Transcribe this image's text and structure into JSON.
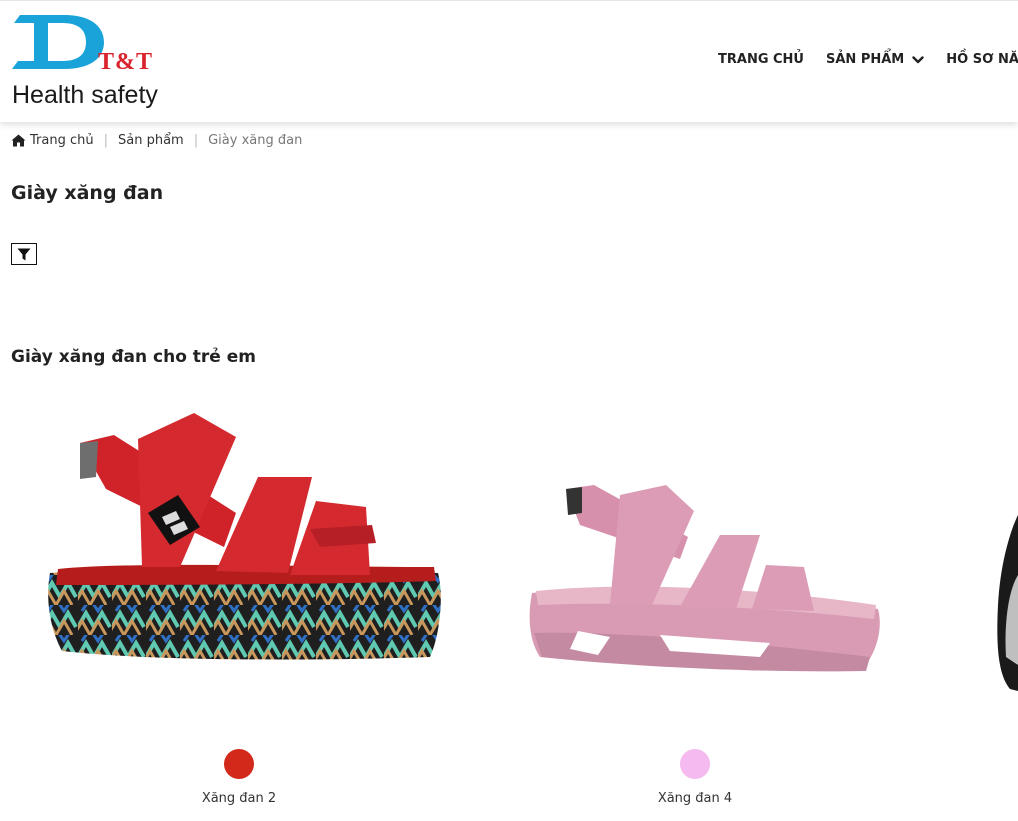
{
  "brand": {
    "logo_letter": "D",
    "logo_mark": "T&T",
    "tagline": "Health safety",
    "colors": {
      "primary_blue": "#1aa3d9",
      "accent_red": "#d9232d"
    }
  },
  "nav": {
    "items": [
      {
        "label": "TRANG CHỦ"
      },
      {
        "label": "SẢN PHẨM",
        "icon": "chevron-down-icon"
      },
      {
        "label": "HỒ SƠ NĂNG"
      }
    ]
  },
  "breadcrumb": {
    "home_icon": "home-icon",
    "home": "Trang chủ",
    "products": "Sản phẩm",
    "current": "Giày xăng đan",
    "separator": "|"
  },
  "page": {
    "title": "Giày xăng đan",
    "filter_icon": "filter-icon",
    "section_title": "Giày xăng đan cho trẻ em"
  },
  "products": [
    {
      "name": "Xăng đan 2",
      "swatch_color": "#d2291b"
    },
    {
      "name": "Xăng đan 4",
      "swatch_color": "#f5baf0"
    }
  ]
}
